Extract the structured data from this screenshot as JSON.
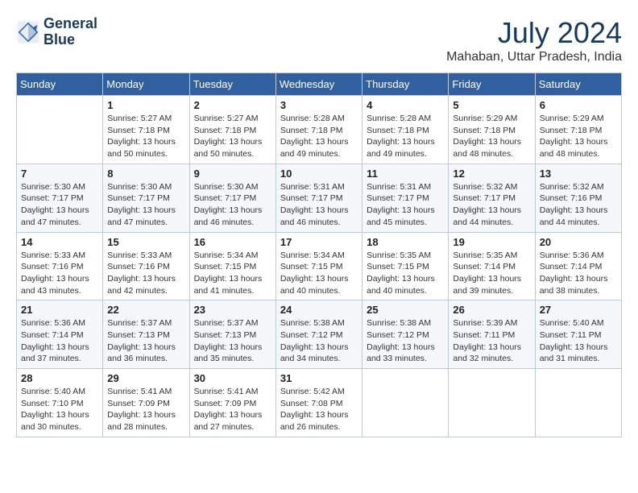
{
  "logo": {
    "line1": "General",
    "line2": "Blue"
  },
  "title": {
    "month_year": "July 2024",
    "location": "Mahaban, Uttar Pradesh, India"
  },
  "days_of_week": [
    "Sunday",
    "Monday",
    "Tuesday",
    "Wednesday",
    "Thursday",
    "Friday",
    "Saturday"
  ],
  "weeks": [
    [
      {
        "day": "",
        "info": ""
      },
      {
        "day": "1",
        "info": "Sunrise: 5:27 AM\nSunset: 7:18 PM\nDaylight: 13 hours\nand 50 minutes."
      },
      {
        "day": "2",
        "info": "Sunrise: 5:27 AM\nSunset: 7:18 PM\nDaylight: 13 hours\nand 50 minutes."
      },
      {
        "day": "3",
        "info": "Sunrise: 5:28 AM\nSunset: 7:18 PM\nDaylight: 13 hours\nand 49 minutes."
      },
      {
        "day": "4",
        "info": "Sunrise: 5:28 AM\nSunset: 7:18 PM\nDaylight: 13 hours\nand 49 minutes."
      },
      {
        "day": "5",
        "info": "Sunrise: 5:29 AM\nSunset: 7:18 PM\nDaylight: 13 hours\nand 48 minutes."
      },
      {
        "day": "6",
        "info": "Sunrise: 5:29 AM\nSunset: 7:18 PM\nDaylight: 13 hours\nand 48 minutes."
      }
    ],
    [
      {
        "day": "7",
        "info": "Sunrise: 5:30 AM\nSunset: 7:17 PM\nDaylight: 13 hours\nand 47 minutes."
      },
      {
        "day": "8",
        "info": "Sunrise: 5:30 AM\nSunset: 7:17 PM\nDaylight: 13 hours\nand 47 minutes."
      },
      {
        "day": "9",
        "info": "Sunrise: 5:30 AM\nSunset: 7:17 PM\nDaylight: 13 hours\nand 46 minutes."
      },
      {
        "day": "10",
        "info": "Sunrise: 5:31 AM\nSunset: 7:17 PM\nDaylight: 13 hours\nand 46 minutes."
      },
      {
        "day": "11",
        "info": "Sunrise: 5:31 AM\nSunset: 7:17 PM\nDaylight: 13 hours\nand 45 minutes."
      },
      {
        "day": "12",
        "info": "Sunrise: 5:32 AM\nSunset: 7:17 PM\nDaylight: 13 hours\nand 44 minutes."
      },
      {
        "day": "13",
        "info": "Sunrise: 5:32 AM\nSunset: 7:16 PM\nDaylight: 13 hours\nand 44 minutes."
      }
    ],
    [
      {
        "day": "14",
        "info": "Sunrise: 5:33 AM\nSunset: 7:16 PM\nDaylight: 13 hours\nand 43 minutes."
      },
      {
        "day": "15",
        "info": "Sunrise: 5:33 AM\nSunset: 7:16 PM\nDaylight: 13 hours\nand 42 minutes."
      },
      {
        "day": "16",
        "info": "Sunrise: 5:34 AM\nSunset: 7:15 PM\nDaylight: 13 hours\nand 41 minutes."
      },
      {
        "day": "17",
        "info": "Sunrise: 5:34 AM\nSunset: 7:15 PM\nDaylight: 13 hours\nand 40 minutes."
      },
      {
        "day": "18",
        "info": "Sunrise: 5:35 AM\nSunset: 7:15 PM\nDaylight: 13 hours\nand 40 minutes."
      },
      {
        "day": "19",
        "info": "Sunrise: 5:35 AM\nSunset: 7:14 PM\nDaylight: 13 hours\nand 39 minutes."
      },
      {
        "day": "20",
        "info": "Sunrise: 5:36 AM\nSunset: 7:14 PM\nDaylight: 13 hours\nand 38 minutes."
      }
    ],
    [
      {
        "day": "21",
        "info": "Sunrise: 5:36 AM\nSunset: 7:14 PM\nDaylight: 13 hours\nand 37 minutes."
      },
      {
        "day": "22",
        "info": "Sunrise: 5:37 AM\nSunset: 7:13 PM\nDaylight: 13 hours\nand 36 minutes."
      },
      {
        "day": "23",
        "info": "Sunrise: 5:37 AM\nSunset: 7:13 PM\nDaylight: 13 hours\nand 35 minutes."
      },
      {
        "day": "24",
        "info": "Sunrise: 5:38 AM\nSunset: 7:12 PM\nDaylight: 13 hours\nand 34 minutes."
      },
      {
        "day": "25",
        "info": "Sunrise: 5:38 AM\nSunset: 7:12 PM\nDaylight: 13 hours\nand 33 minutes."
      },
      {
        "day": "26",
        "info": "Sunrise: 5:39 AM\nSunset: 7:11 PM\nDaylight: 13 hours\nand 32 minutes."
      },
      {
        "day": "27",
        "info": "Sunrise: 5:40 AM\nSunset: 7:11 PM\nDaylight: 13 hours\nand 31 minutes."
      }
    ],
    [
      {
        "day": "28",
        "info": "Sunrise: 5:40 AM\nSunset: 7:10 PM\nDaylight: 13 hours\nand 30 minutes."
      },
      {
        "day": "29",
        "info": "Sunrise: 5:41 AM\nSunset: 7:09 PM\nDaylight: 13 hours\nand 28 minutes."
      },
      {
        "day": "30",
        "info": "Sunrise: 5:41 AM\nSunset: 7:09 PM\nDaylight: 13 hours\nand 27 minutes."
      },
      {
        "day": "31",
        "info": "Sunrise: 5:42 AM\nSunset: 7:08 PM\nDaylight: 13 hours\nand 26 minutes."
      },
      {
        "day": "",
        "info": ""
      },
      {
        "day": "",
        "info": ""
      },
      {
        "day": "",
        "info": ""
      }
    ]
  ]
}
